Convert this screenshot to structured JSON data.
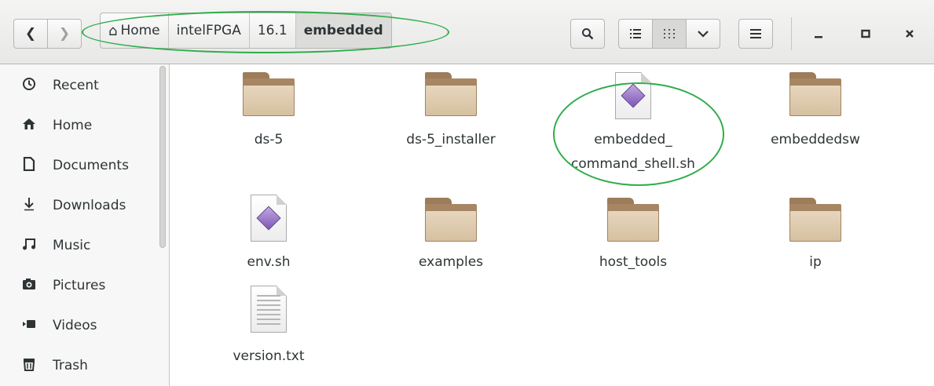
{
  "header": {
    "breadcrumbs": [
      {
        "label": "Home",
        "icon": "home-icon"
      },
      {
        "label": "intelFPGA"
      },
      {
        "label": "16.1"
      },
      {
        "label": "embedded",
        "active": true
      }
    ]
  },
  "sidebar": {
    "items": [
      {
        "label": "Recent",
        "icon": "clock-icon"
      },
      {
        "label": "Home",
        "icon": "home-icon"
      },
      {
        "label": "Documents",
        "icon": "document-icon"
      },
      {
        "label": "Downloads",
        "icon": "download-icon"
      },
      {
        "label": "Music",
        "icon": "music-icon"
      },
      {
        "label": "Pictures",
        "icon": "camera-icon"
      },
      {
        "label": "Videos",
        "icon": "video-icon"
      },
      {
        "label": "Trash",
        "icon": "trash-icon"
      }
    ]
  },
  "files": [
    {
      "name": "ds-5",
      "type": "folder"
    },
    {
      "name": "ds-5_installer",
      "type": "folder"
    },
    {
      "name_line1": "embedded_",
      "name_line2": "command_shell.sh",
      "type": "script"
    },
    {
      "name": "embeddedsw",
      "type": "folder"
    },
    {
      "name": "env.sh",
      "type": "script"
    },
    {
      "name": "examples",
      "type": "folder"
    },
    {
      "name": "host_tools",
      "type": "folder"
    },
    {
      "name": "ip",
      "type": "folder"
    },
    {
      "name": "version.txt",
      "type": "text"
    }
  ],
  "annotation_color": "#2fad4a"
}
